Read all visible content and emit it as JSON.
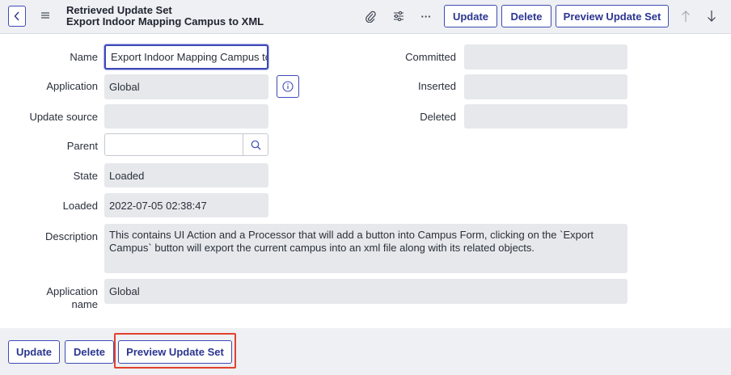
{
  "header": {
    "title_line1": "Retrieved Update Set",
    "title_line2": "Export Indoor Mapping Campus to XML",
    "buttons": {
      "update": "Update",
      "delete": "Delete",
      "preview": "Preview Update Set"
    },
    "more_label": "···",
    "icons": [
      "back-icon",
      "hamburger-icon",
      "paperclip-icon",
      "settings-sliders-icon",
      "more-icon",
      "arrow-up-icon",
      "arrow-down-icon"
    ]
  },
  "form": {
    "name": {
      "label": "Name",
      "value": "Export Indoor Mapping Campus to XML"
    },
    "application": {
      "label": "Application",
      "value": "Global"
    },
    "update_source": {
      "label": "Update source",
      "value": ""
    },
    "parent": {
      "label": "Parent",
      "value": ""
    },
    "state": {
      "label": "State",
      "value": "Loaded"
    },
    "loaded": {
      "label": "Loaded",
      "value": "2022-07-05 02:38:47"
    },
    "description": {
      "label": "Description",
      "value": "This contains UI Action and a Processor that will add a button into Campus Form, clicking on the `Export Campus` button will export the current campus into an xml file along with its related objects."
    },
    "application_name": {
      "label_line1": "Application",
      "label_line2": "name",
      "value": "Global"
    },
    "committed": {
      "label": "Committed",
      "value": ""
    },
    "inserted": {
      "label": "Inserted",
      "value": ""
    },
    "deleted": {
      "label": "Deleted",
      "value": ""
    }
  },
  "footer": {
    "update": "Update",
    "delete": "Delete",
    "preview": "Preview Update Set"
  },
  "colors": {
    "accent": "#3f4bb5",
    "highlight": "#e2412c",
    "readonly_field": "#e6e8eb",
    "header_bg": "#eef0f3"
  }
}
